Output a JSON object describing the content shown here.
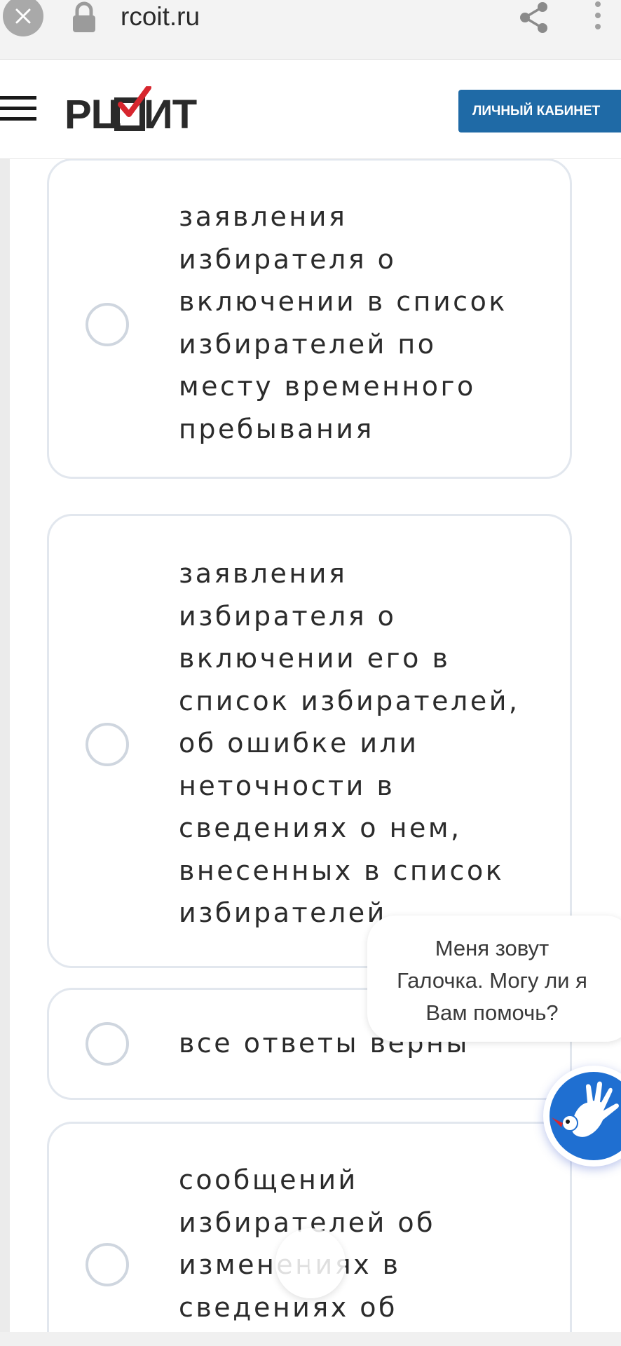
{
  "browser": {
    "url": "rcoit.ru",
    "close_icon": "close-icon",
    "lock_icon": "lock-icon",
    "share_icon": "share-icon",
    "more_icon": "more-vertical-icon"
  },
  "header": {
    "logo_text": "РЦОИТ",
    "menu_icon": "hamburger-menu-icon",
    "cabinet_button": "ЛИЧНЫЙ КАБИНЕТ",
    "accent_color": "#1f6aa6",
    "logo_check_color": "#d7262e"
  },
  "options": [
    {
      "text": "заявления\nизбирателя о\nвключении в список\nизбирателей по\nместу временного\nпребывания",
      "selected": false
    },
    {
      "text": "заявления\nизбирателя о\nвключении его в\nсписок избирателей,\nоб ошибке или\nнеточности в\nсведениях о нем,\nвнесенных в список\nизбирателей",
      "selected": false
    },
    {
      "text": "все ответы верны",
      "selected": false
    },
    {
      "text": "сообщений\nизбирателей об\nизменениях в\nсведениях об",
      "selected": false
    }
  ],
  "chat": {
    "message": "Меня зовут\nГалочка. Могу ли я\nВам помочь?",
    "avatar_icon": "assistant-bird-hand-icon",
    "avatar_color": "#1f6fd1"
  },
  "scroll_top": {
    "icon": "arrow-up-icon",
    "label": "↑"
  }
}
